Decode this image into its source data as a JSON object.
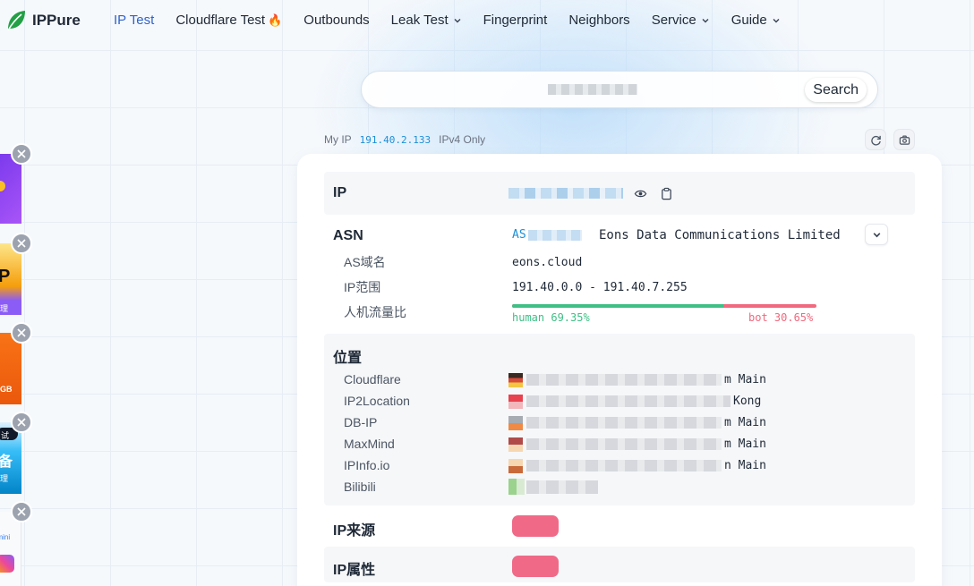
{
  "brand": {
    "name": "IPPure",
    "icon": "leaf-icon",
    "color": "#22a045"
  },
  "nav": {
    "items": [
      {
        "label": "IP Test",
        "active": true
      },
      {
        "label": "Cloudflare Test",
        "badge": "🔥"
      },
      {
        "label": "Outbounds"
      },
      {
        "label": "Leak Test",
        "dropdown": true
      },
      {
        "label": "Fingerprint"
      },
      {
        "label": "Neighbors"
      },
      {
        "label": "Service",
        "dropdown": true
      },
      {
        "label": "Guide",
        "dropdown": true
      }
    ],
    "active_color": "#2f63c9"
  },
  "search": {
    "value": "",
    "button_label": "Search"
  },
  "my_ip": {
    "label": "My IP",
    "value": "191.40.2.133",
    "mode": "IPv4 Only"
  },
  "card": {
    "ip": {
      "title": "IP"
    },
    "asn": {
      "title": "ASN",
      "as_prefix": "AS",
      "org": "Eons Data Communications Limited",
      "rows": [
        {
          "label": "AS域名",
          "value": "eons.cloud"
        },
        {
          "label": "IP范围",
          "value": "191.40.0.0 - 191.40.7.255"
        },
        {
          "label": "人机流量比"
        }
      ],
      "traffic": {
        "human_label": "human 69.35%",
        "bot_label": "bot 30.65%",
        "human_ratio": 0.6935,
        "human_color": "#3fbf86",
        "bot_color": "#f06a7e"
      }
    },
    "location": {
      "title": "位置",
      "sources": [
        {
          "name": "Cloudflare",
          "tail": "m Main"
        },
        {
          "name": "IP2Location",
          "tail": "Kong"
        },
        {
          "name": "DB-IP",
          "tail": "m Main"
        },
        {
          "name": "MaxMind",
          "tail": "m Main"
        },
        {
          "name": "IPInfo.io",
          "tail": "n Main"
        },
        {
          "name": "Bilibili",
          "tail": ""
        }
      ]
    },
    "ip_source": {
      "title": "IP来源"
    },
    "ip_attr": {
      "title": "IP属性"
    }
  },
  "ads": [
    {
      "text": "P",
      "color": "#f59e0b"
    },
    {
      "text": "理",
      "color": "#8b5cf6"
    },
    {
      "text": "GB",
      "color": "#ea580c"
    },
    {
      "text": "试",
      "color": "#111827"
    },
    {
      "text": "备",
      "color": "#1d8fd6"
    },
    {
      "text": "理",
      "color": "#1d8fd6"
    },
    {
      "text": "emini",
      "color": "#3b82f6"
    }
  ]
}
